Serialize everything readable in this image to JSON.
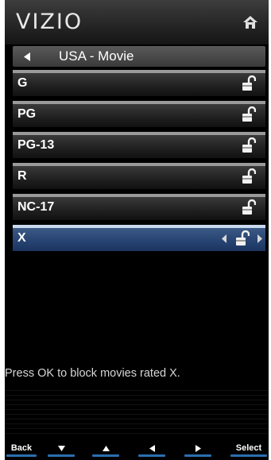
{
  "header": {
    "logo": "VIZIO",
    "home_icon": "home-icon"
  },
  "breadcrumb": {
    "label": "USA - Movie",
    "back_icon": "left-triangle-icon"
  },
  "ratings": [
    {
      "label": "G",
      "lock": "unlocked-icon",
      "selected": false
    },
    {
      "label": "PG",
      "lock": "unlocked-icon",
      "selected": false
    },
    {
      "label": "PG-13",
      "lock": "unlocked-icon",
      "selected": false
    },
    {
      "label": "R",
      "lock": "unlocked-icon",
      "selected": false
    },
    {
      "label": "NC-17",
      "lock": "unlocked-icon",
      "selected": false
    },
    {
      "label": "X",
      "lock": "unlocked-icon",
      "selected": true
    }
  ],
  "message": "Press OK to block movies rated X.",
  "footer": {
    "back": "Back",
    "down_icon": "down-arrow-icon",
    "up_icon": "up-arrow-icon",
    "left_icon": "left-arrow-icon",
    "right_icon": "right-arrow-icon",
    "select": "Select"
  },
  "colors": {
    "selected_row": "#274472",
    "row": "#1f1f1f",
    "accent": "#2b6fb0"
  }
}
